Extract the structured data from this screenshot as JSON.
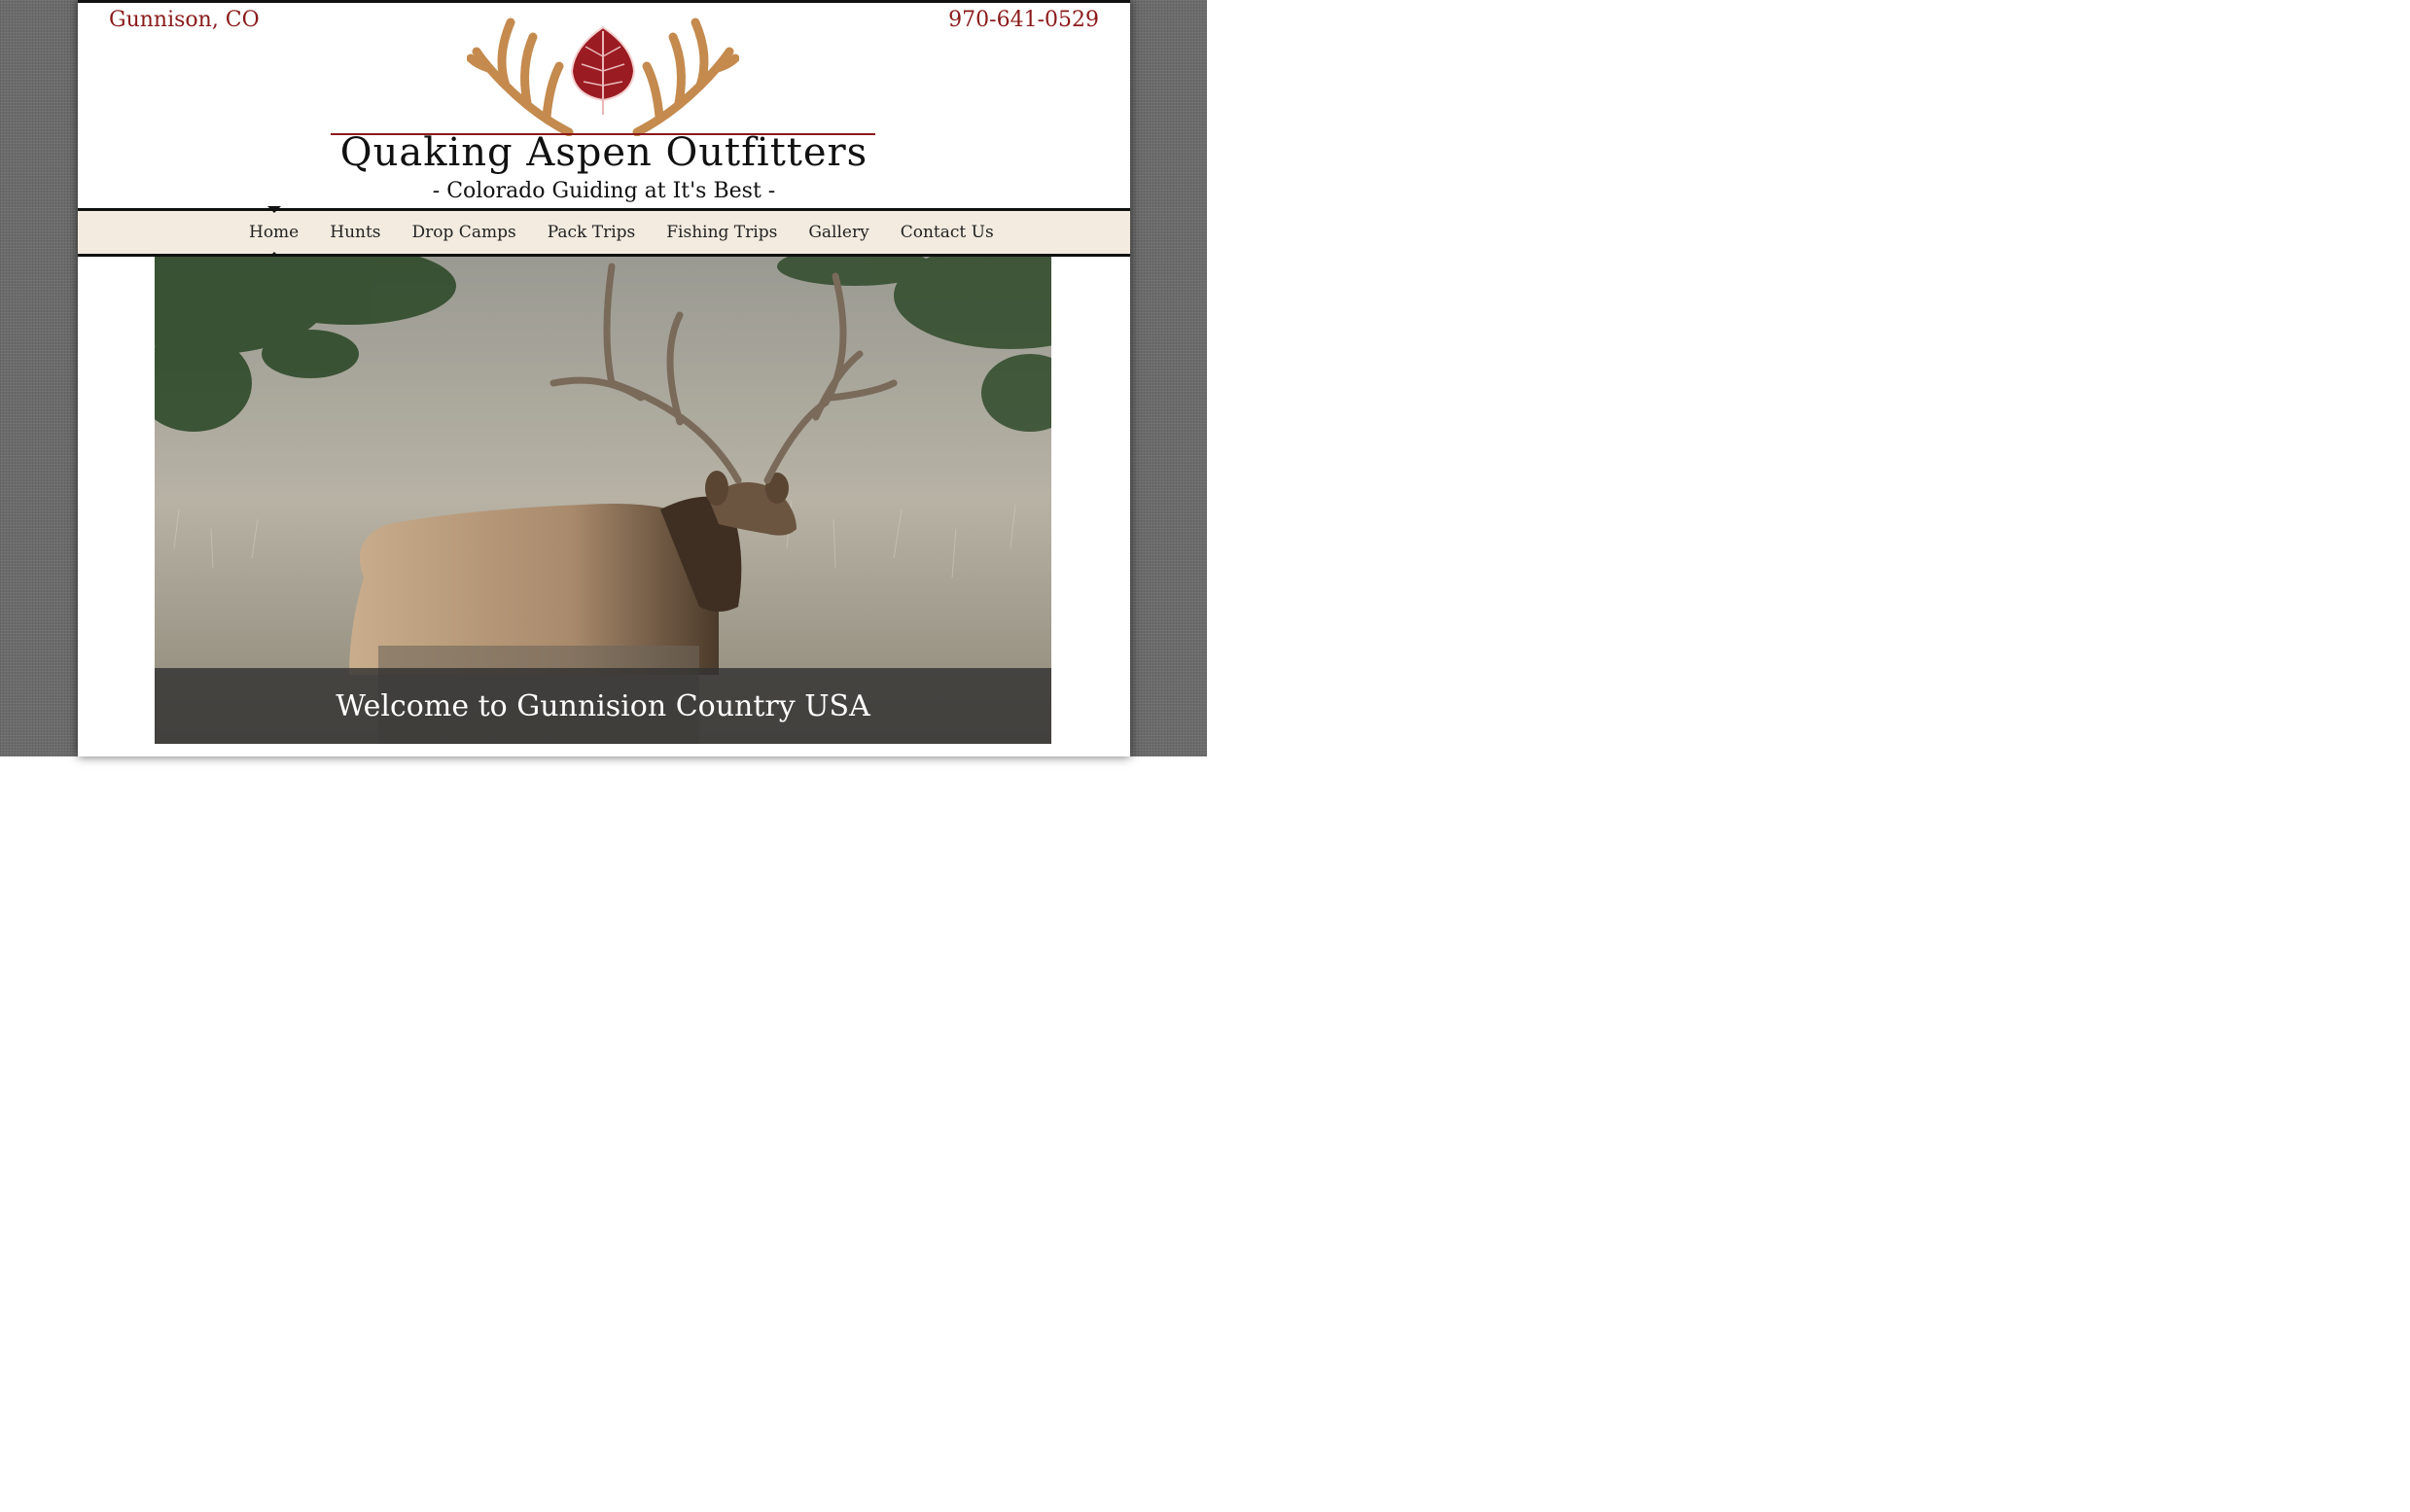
{
  "header": {
    "location": "Gunnison, CO",
    "phone": "970-641-0529",
    "title": "Quaking Aspen Outfitters",
    "tagline": "- Colorado Guiding at It's Best -",
    "logo_icon": "antlers-aspen-leaf-icon"
  },
  "nav": {
    "items": [
      {
        "label": "Home",
        "active": true
      },
      {
        "label": "Hunts"
      },
      {
        "label": "Drop Camps"
      },
      {
        "label": "Pack Trips"
      },
      {
        "label": "Fishing Trips"
      },
      {
        "label": "Gallery"
      },
      {
        "label": "Contact Us"
      }
    ]
  },
  "hero": {
    "caption": "Welcome to Gunnision Country USA"
  },
  "colors": {
    "accent": "#8b1a1a",
    "nav_bg": "#f3ebe0",
    "backdrop": "#6b6b6b"
  }
}
